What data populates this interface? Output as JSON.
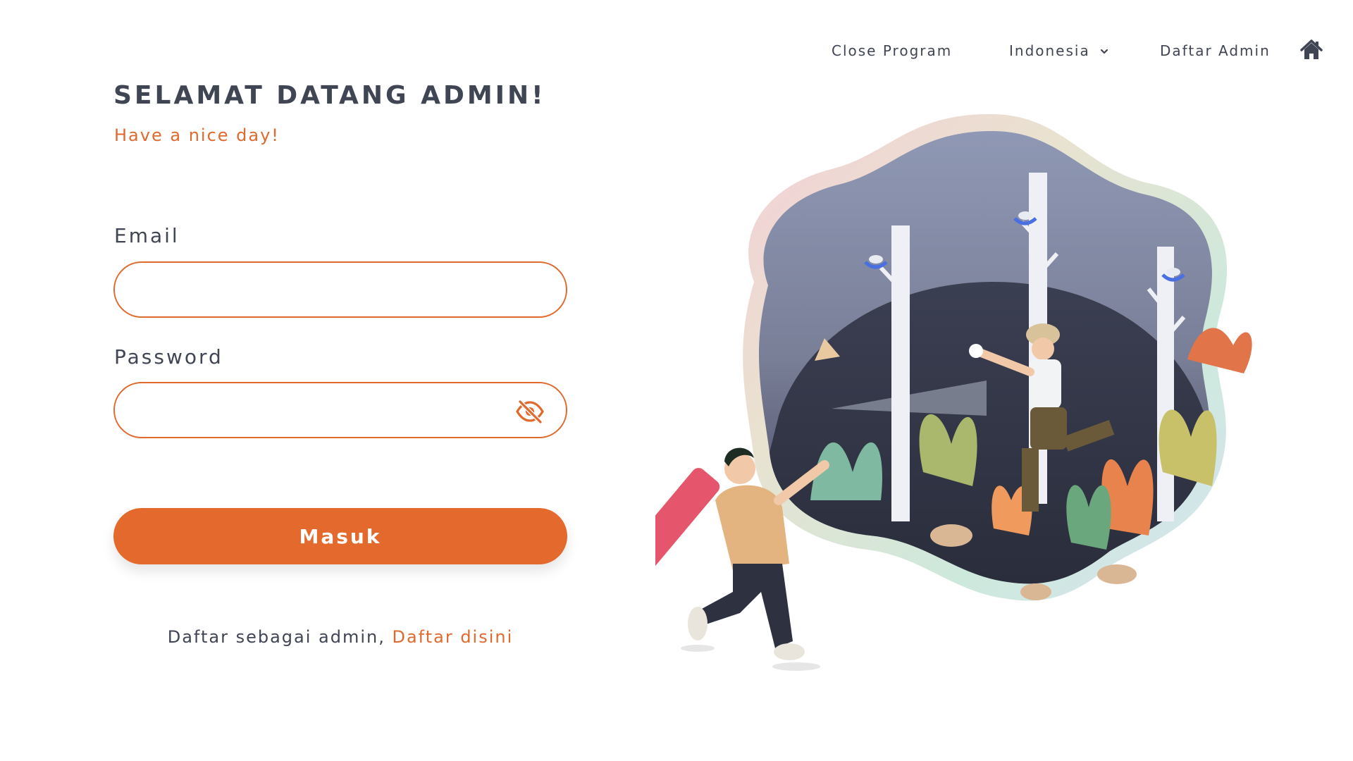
{
  "nav": {
    "close_program": "Close Program",
    "language": "Indonesia",
    "daftar_admin": "Daftar Admin",
    "home_icon": "home-icon",
    "language_icon": "chevron-down-icon"
  },
  "header": {
    "title": "SELAMAT DATANG ADMIN!",
    "subtitle": "Have a nice day!"
  },
  "form": {
    "email_label": "Email",
    "email_value": "",
    "email_placeholder": "",
    "password_label": "Password",
    "password_value": "",
    "password_placeholder": "",
    "password_toggle_icon": "eye-slash-icon",
    "submit_label": "Masuk"
  },
  "footer": {
    "register_text": "Daftar sebagai admin,",
    "register_link": "Daftar disini"
  },
  "colors": {
    "accent": "#e06a2e",
    "text": "#3f4553",
    "button": "#e36a2c"
  }
}
